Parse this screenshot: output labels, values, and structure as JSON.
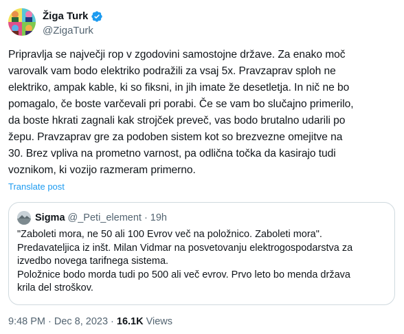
{
  "author": {
    "display_name": "Žiga Turk",
    "handle": "@ZigaTurk",
    "verified_color": "#1d9bf0",
    "avatar_icon": "popart-portrait-avatar"
  },
  "tweet": {
    "text": "Pripravlja se največji rop v zgodovini samostojne države. Za enako moč\nvarovalk vam bodo elektriko podražili za vsaj 5x. Pravzaprav sploh ne\nelektriko, ampak kable, ki so fiksni, in jih imate že desetletja. In nič ne bo\npomagalo, če boste varčevali pri porabi. Če se vam bo slučajno primerilo,\nda boste hkrati zagnali kak strojček preveč, vas bodo brutalno udarili po\nžepu. Pravzaprav gre za podoben sistem kot so brezvezne omejitve na\n30. Brez vpliva na prometno varnost, pa odlična točka da kasirajo tudi\nvoznikom, ki vozijo razmeram primerno.",
    "translate_label": "Translate post"
  },
  "quoted": {
    "name": "Sigma",
    "handle": "@_Peti_element",
    "dot": "·",
    "time": "19h",
    "text": "\"Zaboleti mora, ne 50 ali 100 Evrov več na položnico. Zaboleti mora\".\nPredavateljica iz inšt. Milan Vidmar na posvetovanju elektrogospodarstva za\nizvedbo novega tarifnega sistema.\nPoložnice bodo morda tudi po 500 ali več evrov. Prvo leto bo menda država\nkrila del stroškov."
  },
  "meta": {
    "time": "9:48 PM",
    "dot1": "·",
    "date": "Dec 8, 2023",
    "dot2": "·",
    "views_count": "16.1K",
    "views_label": "Views"
  }
}
